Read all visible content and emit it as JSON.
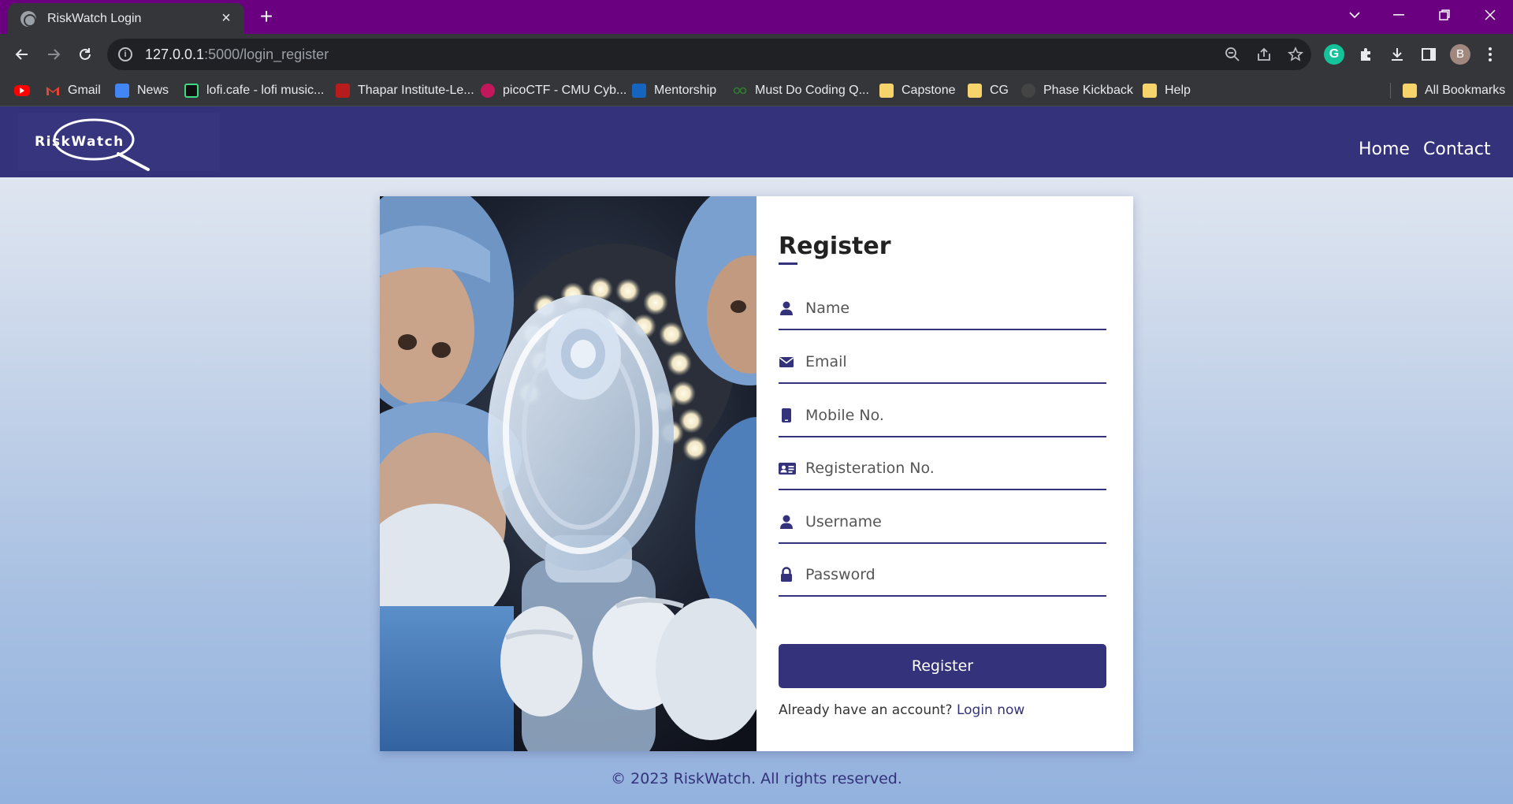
{
  "browser": {
    "tab_title": "RiskWatch Login",
    "tab_close": "×",
    "new_tab": "+",
    "url_host": "127.0.0.1",
    "url_path": ":5000/login_register",
    "profile_initial": "B",
    "bookmarks": [
      {
        "label": "Gmail",
        "color": "#ea4335"
      },
      {
        "label": "News",
        "color": "#4285f4"
      },
      {
        "label": "lofi.cafe - lofi music...",
        "color": "#111111"
      },
      {
        "label": "Thapar Institute-Le...",
        "color": "#b71c1c"
      },
      {
        "label": "picoCTF - CMU Cyb...",
        "color": "#c2185b"
      },
      {
        "label": "Mentorship",
        "color": "#1565c0"
      },
      {
        "label": "Must Do Coding Q...",
        "color": "#2e7d32"
      },
      {
        "label": "Capstone",
        "color": "#f6d36b"
      },
      {
        "label": "CG",
        "color": "#f6d36b"
      },
      {
        "label": "Phase Kickback",
        "color": "#444444"
      },
      {
        "label": "Help",
        "color": "#f6d36b"
      }
    ],
    "all_bookmarks": "All Bookmarks"
  },
  "site": {
    "logo_text": "RiskWatch",
    "nav": {
      "home": "Home",
      "contact": "Contact"
    }
  },
  "form": {
    "title": "Register",
    "fields": {
      "name": "Name",
      "email": "Email",
      "mobile": "Mobile No.",
      "registration": "Registeration No.",
      "username": "Username",
      "password": "Password"
    },
    "submit": "Register",
    "login_prompt": "Already have an account?",
    "login_link": "Login now"
  },
  "footer": "© 2023 RiskWatch. All rights reserved.",
  "colors": {
    "brand": "#33327a",
    "browser_accent": "#6a007f"
  }
}
